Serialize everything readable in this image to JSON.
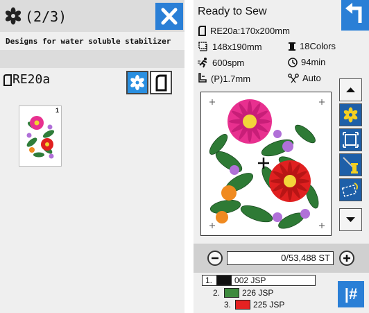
{
  "left": {
    "page_count": "(2/3)",
    "category_title": "Designs for water soluble stabilizer",
    "hoop_label": "RE20a",
    "thumbnail_number": "1"
  },
  "right": {
    "title": "Ready to Sew",
    "hoop_info": "RE20a:170x200mm",
    "design_size": "148x190mm",
    "colors": "18Colors",
    "speed": "600spm",
    "time": "94min",
    "presser": "(P)1.7mm",
    "thread_cut": "Auto",
    "stitch_counter": "0/53,488 ST",
    "thread_list": [
      {
        "index": "1.",
        "code": "002",
        "brand": "JSP",
        "color": "#111111"
      },
      {
        "index": "2.",
        "code": "226",
        "brand": "JSP",
        "color": "#3d8a3d"
      },
      {
        "index": "3.",
        "code": "225",
        "brand": "JSP",
        "color": "#e52222"
      }
    ],
    "hash_label": "|#"
  },
  "colors": {
    "accent_blue": "#2a7fd6",
    "panel_bg": "#efefef",
    "header_bg": "#dcdcdc"
  },
  "icons": {
    "page_flower": "flower-icon",
    "close": "close-icon",
    "back": "back-arrow-icon",
    "hoop": "hoop-icon",
    "scroll_up": "triangle-up-icon",
    "scroll_down": "triangle-down-icon"
  }
}
